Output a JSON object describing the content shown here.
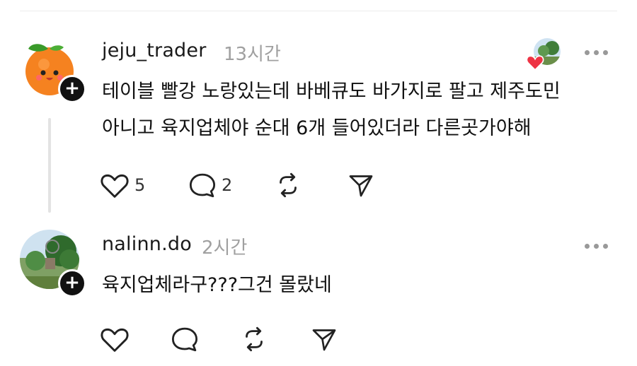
{
  "posts": [
    {
      "username": "jeju_trader",
      "time": "13시간",
      "text": "테이블 빨강 노랑있는데 바베큐도 바가지로 팔고 제주도민\n아니고 육지업체야 순대 6개 들어있더라 다른곳가야해",
      "likes": "5",
      "comments": "2",
      "avatar": "orange-fruit-avatar",
      "liked_by_author": true
    },
    {
      "username": "nalinn.do",
      "time": "2시간",
      "text": "육지업체라구???그건 몰랐네",
      "avatar": "tree-landscape-avatar"
    }
  ],
  "icons": {
    "like": "heart-icon",
    "comment": "comment-bubble-icon",
    "repost": "repost-icon",
    "share": "send-icon",
    "more": "more-icon",
    "follow": "plus-icon"
  },
  "colors": {
    "text": "#111111",
    "muted": "#a0a0a0",
    "heart": "#ee3344",
    "divider": "#ececec"
  }
}
